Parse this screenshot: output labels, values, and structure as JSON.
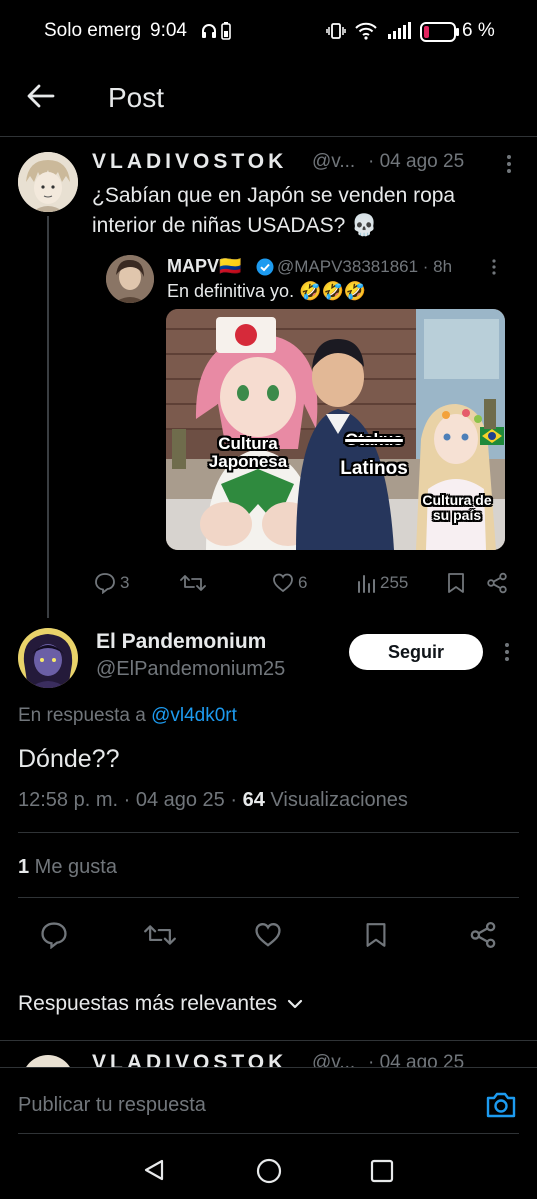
{
  "status_bar": {
    "carrier": "Solo emerg",
    "time": "9:04",
    "battery_percent": "6 %"
  },
  "header": {
    "title": "Post",
    "back_icon": "arrow-left-icon"
  },
  "original_post": {
    "display_name": "VLADIVOSTOK",
    "handle": "@v...",
    "date": "· 04 ago 25",
    "text": "¿Sabían que en Japón se venden ropa interior de niñas USADAS? 💀",
    "quoted_post": {
      "display_name": "MAPV",
      "flag": "🇨🇴",
      "handle_time": "@MAPV38381861 · 8h",
      "text": "En definitiva yo. 🤣🤣🤣",
      "meme_labels": {
        "left": "Cultura Japonesa",
        "middle_struck": "Otakus",
        "middle": "Latinos",
        "right": "Cultura de su país"
      }
    },
    "actions": {
      "replies": "3",
      "reposts": "",
      "likes": "6",
      "views": "255"
    }
  },
  "reply_post": {
    "display_name": "El Pandemonium",
    "handle": "@ElPandemonium25",
    "follow_label": "Seguir",
    "in_reply_prefix": "En respuesta a ",
    "in_reply_handle": "@vl4dk0rt",
    "text": "Dónde??",
    "meta_time_date": "12:58 p. m. · 04 ago 25 · ",
    "meta_views_count": "64",
    "meta_views_label": " Visualizaciones",
    "likes_count": "1",
    "likes_label": " Me gusta"
  },
  "replies_sort": {
    "label": "Respuestas más relevantes"
  },
  "next_post_peek": {
    "display_name": "VLADIVOSTOK",
    "handle": "@v...",
    "date": "· 04 ago 25"
  },
  "composer": {
    "placeholder": "Publicar tu respuesta"
  },
  "colors": {
    "background": "#000000",
    "text": "#e7e9ea",
    "muted": "#71767b",
    "link": "#1d9bf0",
    "divider": "#2f3336",
    "battery_low": "#e0245e"
  }
}
